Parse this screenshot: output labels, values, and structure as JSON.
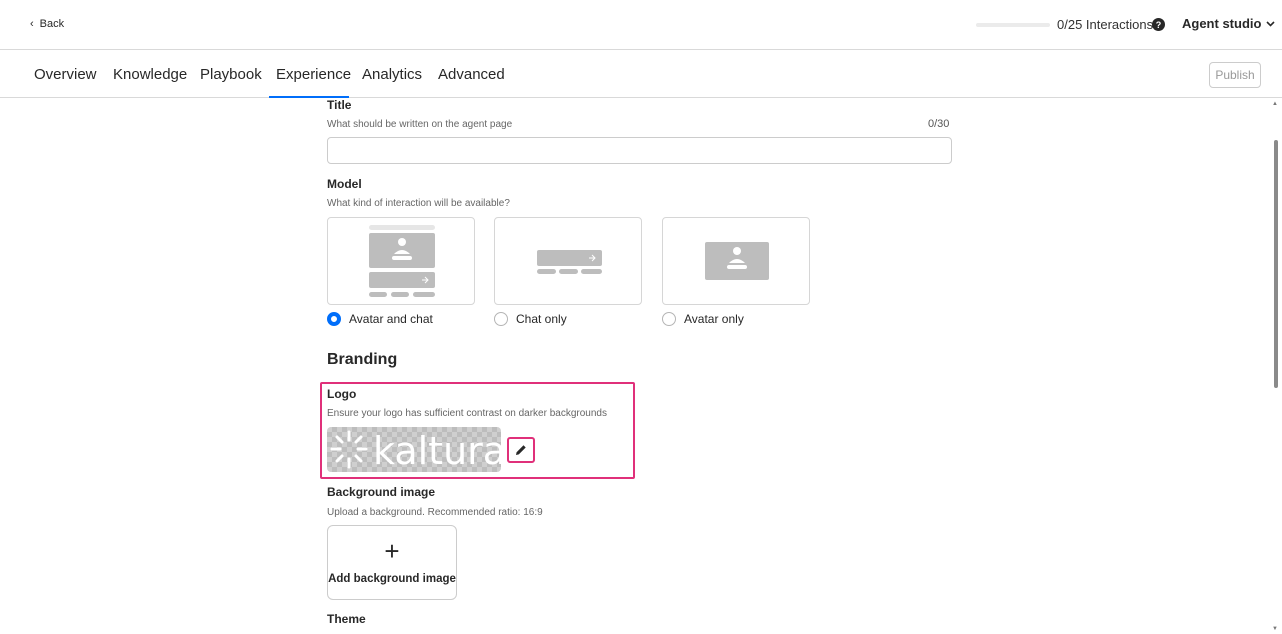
{
  "topbar": {
    "back_label": "Back",
    "interactions_label": "0/25 Interactions",
    "interactions_progress": 0,
    "help_glyph": "?",
    "agent_studio_label": "Agent studio"
  },
  "tabs": [
    {
      "label": "Overview"
    },
    {
      "label": "Knowledge"
    },
    {
      "label": "Playbook"
    },
    {
      "label": "Experience",
      "active": true
    },
    {
      "label": "Analytics"
    },
    {
      "label": "Advanced"
    }
  ],
  "publish_label": "Publish",
  "form": {
    "title": {
      "label": "Title",
      "hint": "What should be written on the agent page",
      "counter": "0/30",
      "value": ""
    },
    "model": {
      "label": "Model",
      "hint": "What kind of interaction will be available?",
      "options": [
        {
          "label": "Avatar and chat",
          "selected": true
        },
        {
          "label": "Chat only",
          "selected": false
        },
        {
          "label": "Avatar only",
          "selected": false
        }
      ]
    },
    "branding": {
      "heading": "Branding",
      "logo": {
        "label": "Logo",
        "hint": "Ensure your logo has sufficient contrast on darker backgrounds",
        "image_text": "kaltura"
      },
      "background": {
        "label": "Background image",
        "hint": "Upload a background. Recommended ratio: 16:9",
        "add_label": "Add background image",
        "add_glyph": "+"
      },
      "theme": {
        "label": "Theme"
      }
    }
  },
  "colors": {
    "accent": "#006efa",
    "highlight": "#e0307a",
    "text": "#282828",
    "muted": "#666666",
    "border": "#d9d9d9"
  },
  "icons": {
    "back": "chevron-left-icon",
    "help": "help-circle-icon",
    "agent_studio_caret": "chevron-down-icon",
    "edit": "pencil-icon",
    "add": "plus-icon"
  }
}
